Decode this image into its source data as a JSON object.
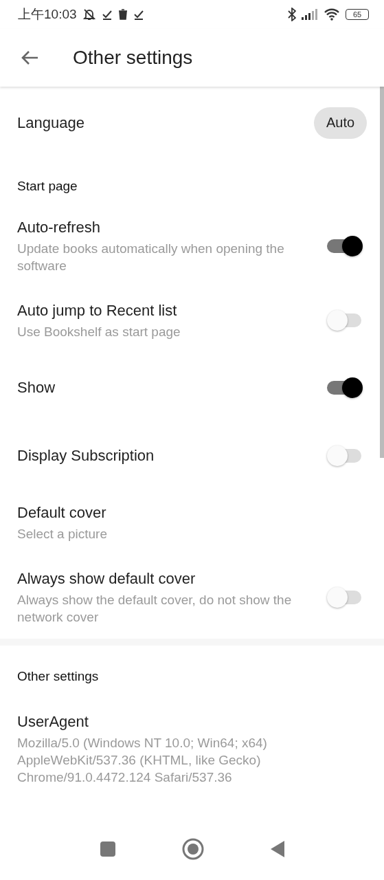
{
  "status_bar": {
    "time": "上午10:03",
    "battery": "65"
  },
  "app_bar": {
    "title": "Other settings"
  },
  "sections": [
    {
      "items": [
        {
          "kind": "value",
          "title": "Language",
          "value": "Auto"
        },
        {
          "kind": "header",
          "title": "Start page"
        },
        {
          "kind": "switch",
          "title": "Auto-refresh",
          "summary": "Update books automatically when opening the software",
          "on": true
        },
        {
          "kind": "switch",
          "title": "Auto jump to Recent list",
          "summary": "Use Bookshelf as start page",
          "on": false
        },
        {
          "kind": "switch",
          "title": "Show",
          "on": true
        },
        {
          "kind": "switch",
          "title": "Display Subscription",
          "on": false
        },
        {
          "kind": "plain",
          "title": "Default cover",
          "summary": "Select a picture"
        },
        {
          "kind": "switch",
          "title": "Always show default cover",
          "summary": "Always show the default cover, do not show the network cover",
          "on": false
        }
      ]
    },
    {
      "items": [
        {
          "kind": "header",
          "title": "Other settings"
        },
        {
          "kind": "plain",
          "title": "UserAgent",
          "summary": "Mozilla/5.0 (Windows NT 10.0; Win64; x64) AppleWebKit/537.36 (KHTML, like Gecko) Chrome/91.0.4472.124 Safari/537.36"
        }
      ]
    }
  ]
}
